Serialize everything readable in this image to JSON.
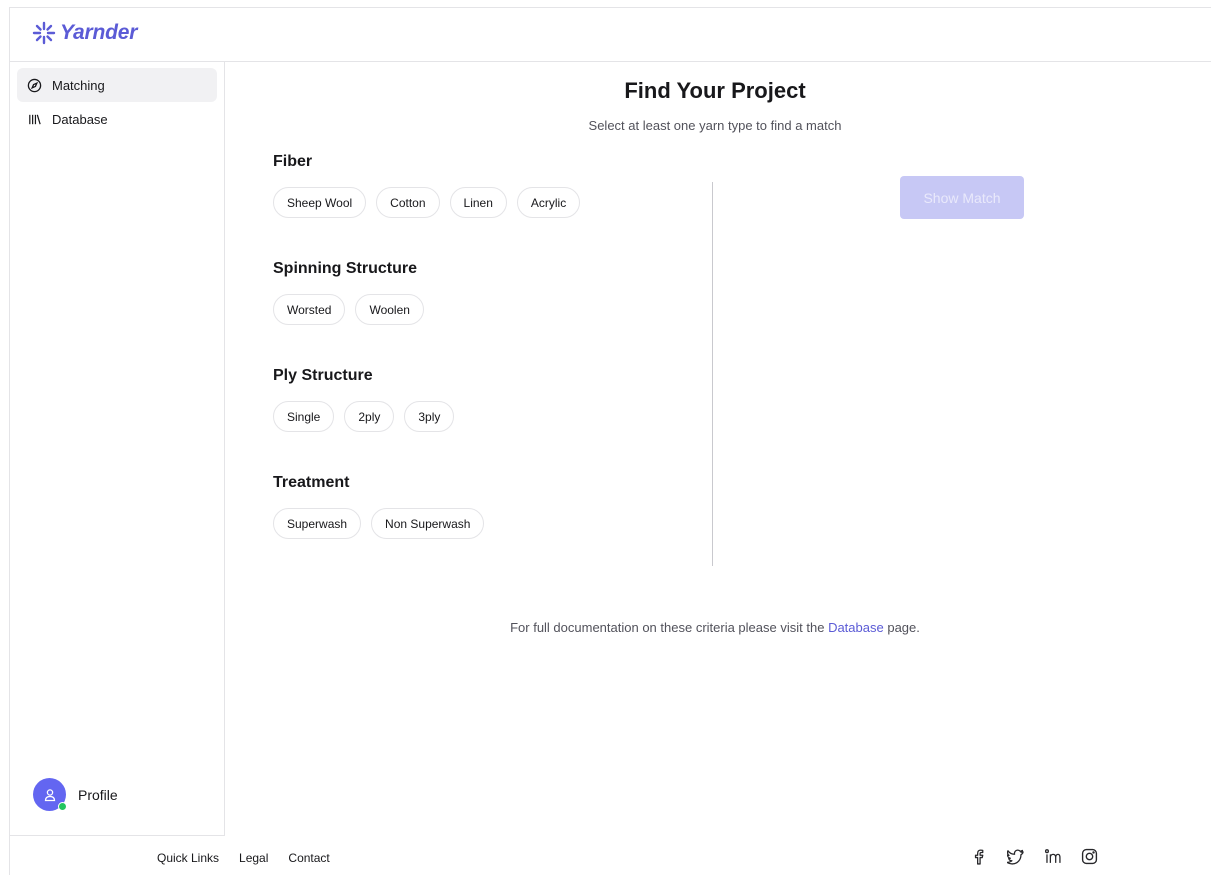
{
  "app": {
    "name": "Yarnder",
    "brand_color": "#5b5bd6"
  },
  "sidebar": {
    "items": [
      {
        "label": "Matching",
        "icon": "compass-icon",
        "active": true
      },
      {
        "label": "Database",
        "icon": "library-icon",
        "active": false
      }
    ],
    "profile": {
      "label": "Profile",
      "icon": "user-icon",
      "status": "online"
    }
  },
  "main": {
    "title": "Find Your Project",
    "subtitle": "Select at least one yarn type to find a match",
    "groups": [
      {
        "title": "Fiber",
        "options": [
          "Sheep Wool",
          "Cotton",
          "Linen",
          "Acrylic"
        ]
      },
      {
        "title": "Spinning Structure",
        "options": [
          "Worsted",
          "Woolen"
        ]
      },
      {
        "title": "Ply Structure",
        "options": [
          "Single",
          "2ply",
          "3ply"
        ]
      },
      {
        "title": "Treatment",
        "options": [
          "Superwash",
          "Non Superwash"
        ]
      }
    ],
    "show_match_label": "Show Match",
    "show_match_disabled": true,
    "doc_note": {
      "prefix": "For full documentation on these criteria please visit the",
      "link": "Database",
      "suffix": "page."
    }
  },
  "footer": {
    "links": [
      "Quick Links",
      "Legal",
      "Contact"
    ],
    "social": [
      "facebook-icon",
      "twitter-icon",
      "linkedin-icon",
      "instagram-icon"
    ]
  }
}
